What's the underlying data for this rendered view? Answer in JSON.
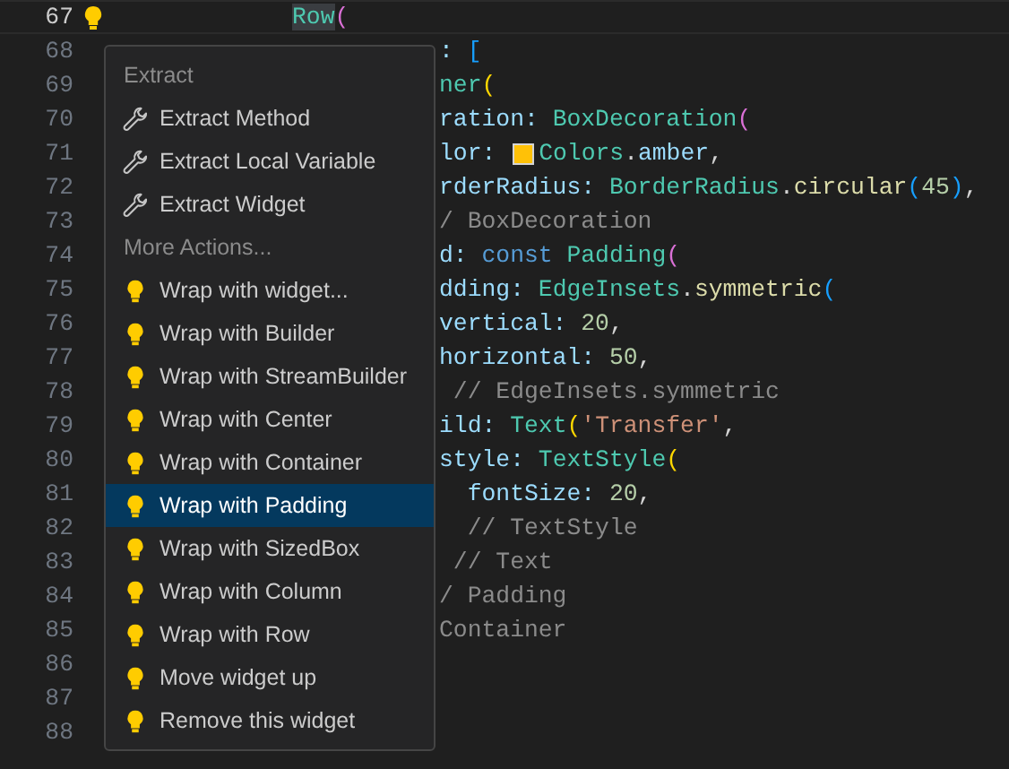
{
  "editor": {
    "lines": [
      {
        "number": "67",
        "current": true,
        "tokens": [
          {
            "text": "Row",
            "kind": "type"
          },
          {
            "text": "(",
            "kind": "bracket2"
          }
        ]
      },
      {
        "number": "68",
        "current": false,
        "tokens": [
          {
            "text": ": ",
            "kind": "prop"
          },
          {
            "text": "[",
            "kind": "bracket3"
          }
        ]
      },
      {
        "number": "69",
        "current": false,
        "tokens": [
          {
            "text": "ner",
            "kind": "type"
          },
          {
            "text": "(",
            "kind": "bracket1"
          }
        ]
      },
      {
        "number": "70",
        "current": false,
        "tokens": [
          {
            "text": "ration: ",
            "kind": "prop"
          },
          {
            "text": "BoxDecoration",
            "kind": "type"
          },
          {
            "text": "(",
            "kind": "bracket2"
          }
        ]
      },
      {
        "number": "71",
        "current": false,
        "tokens": [
          {
            "text": "lor: ",
            "kind": "prop"
          },
          {
            "kind": "swatch",
            "color": "#ffc107"
          },
          {
            "text": "Colors",
            "kind": "type"
          },
          {
            "text": ".",
            "kind": "punct"
          },
          {
            "text": "amber",
            "kind": "prop"
          },
          {
            "text": ",",
            "kind": "punct"
          }
        ]
      },
      {
        "number": "72",
        "current": false,
        "tokens": [
          {
            "text": "rderRadius: ",
            "kind": "prop"
          },
          {
            "text": "BorderRadius",
            "kind": "type"
          },
          {
            "text": ".",
            "kind": "punct"
          },
          {
            "text": "circular",
            "kind": "func"
          },
          {
            "text": "(",
            "kind": "bracket3"
          },
          {
            "text": "45",
            "kind": "number"
          },
          {
            "text": ")",
            "kind": "bracket3"
          },
          {
            "text": ",",
            "kind": "punct"
          }
        ]
      },
      {
        "number": "73",
        "current": false,
        "tokens": [
          {
            "text": "/ BoxDecoration",
            "kind": "comment"
          }
        ]
      },
      {
        "number": "74",
        "current": false,
        "tokens": [
          {
            "text": "d: ",
            "kind": "prop"
          },
          {
            "text": "const ",
            "kind": "keyword"
          },
          {
            "text": "Padding",
            "kind": "type"
          },
          {
            "text": "(",
            "kind": "bracket2"
          }
        ]
      },
      {
        "number": "75",
        "current": false,
        "tokens": [
          {
            "text": "dding: ",
            "kind": "prop"
          },
          {
            "text": "EdgeInsets",
            "kind": "type"
          },
          {
            "text": ".",
            "kind": "punct"
          },
          {
            "text": "symmetric",
            "kind": "func"
          },
          {
            "text": "(",
            "kind": "bracket3"
          }
        ]
      },
      {
        "number": "76",
        "current": false,
        "tokens": [
          {
            "text": "vertical: ",
            "kind": "prop"
          },
          {
            "text": "20",
            "kind": "number"
          },
          {
            "text": ",",
            "kind": "punct"
          }
        ]
      },
      {
        "number": "77",
        "current": false,
        "tokens": [
          {
            "text": "horizontal: ",
            "kind": "prop"
          },
          {
            "text": "50",
            "kind": "number"
          },
          {
            "text": ",",
            "kind": "punct"
          }
        ]
      },
      {
        "number": "78",
        "current": false,
        "tokens": [
          {
            "text": " // EdgeInsets.symmetric",
            "kind": "comment"
          }
        ]
      },
      {
        "number": "79",
        "current": false,
        "tokens": [
          {
            "text": "ild: ",
            "kind": "prop"
          },
          {
            "text": "Text",
            "kind": "type"
          },
          {
            "text": "(",
            "kind": "bracket1"
          },
          {
            "text": "'Transfer'",
            "kind": "str"
          },
          {
            "text": ",",
            "kind": "punct"
          }
        ]
      },
      {
        "number": "80",
        "current": false,
        "tokens": [
          {
            "text": "style: ",
            "kind": "prop"
          },
          {
            "text": "TextStyle",
            "kind": "type"
          },
          {
            "text": "(",
            "kind": "bracket1"
          }
        ]
      },
      {
        "number": "81",
        "current": false,
        "tokens": [
          {
            "text": "  fontSize: ",
            "kind": "prop"
          },
          {
            "text": "20",
            "kind": "number"
          },
          {
            "text": ",",
            "kind": "punct"
          }
        ]
      },
      {
        "number": "82",
        "current": false,
        "tokens": [
          {
            "text": "  // TextStyle",
            "kind": "comment"
          }
        ]
      },
      {
        "number": "83",
        "current": false,
        "tokens": [
          {
            "text": " // Text",
            "kind": "comment"
          }
        ]
      },
      {
        "number": "84",
        "current": false,
        "tokens": [
          {
            "text": "/ Padding",
            "kind": "comment"
          }
        ]
      },
      {
        "number": "85",
        "current": false,
        "tokens": [
          {
            "text": "Container",
            "kind": "comment"
          }
        ]
      },
      {
        "number": "86",
        "current": false
      },
      {
        "number": "87",
        "current": false
      },
      {
        "number": "88",
        "current": false
      }
    ]
  },
  "menu": {
    "sections": [
      {
        "header": "Extract",
        "items": [
          {
            "label": "Extract Method",
            "selected": false
          },
          {
            "label": "Extract Local Variable",
            "selected": false
          },
          {
            "label": "Extract Widget",
            "selected": false
          }
        ]
      },
      {
        "header": "More Actions...",
        "items": [
          {
            "label": "Wrap with widget...",
            "selected": false
          },
          {
            "label": "Wrap with Builder",
            "selected": false
          },
          {
            "label": "Wrap with StreamBuilder",
            "selected": false
          },
          {
            "label": "Wrap with Center",
            "selected": false
          },
          {
            "label": "Wrap with Container",
            "selected": false
          },
          {
            "label": "Wrap with Padding",
            "selected": true
          },
          {
            "label": "Wrap with SizedBox",
            "selected": false
          },
          {
            "label": "Wrap with Column",
            "selected": false
          },
          {
            "label": "Wrap with Row",
            "selected": false
          },
          {
            "label": "Move widget up",
            "selected": false
          },
          {
            "label": "Remove this widget",
            "selected": false
          }
        ]
      }
    ]
  }
}
